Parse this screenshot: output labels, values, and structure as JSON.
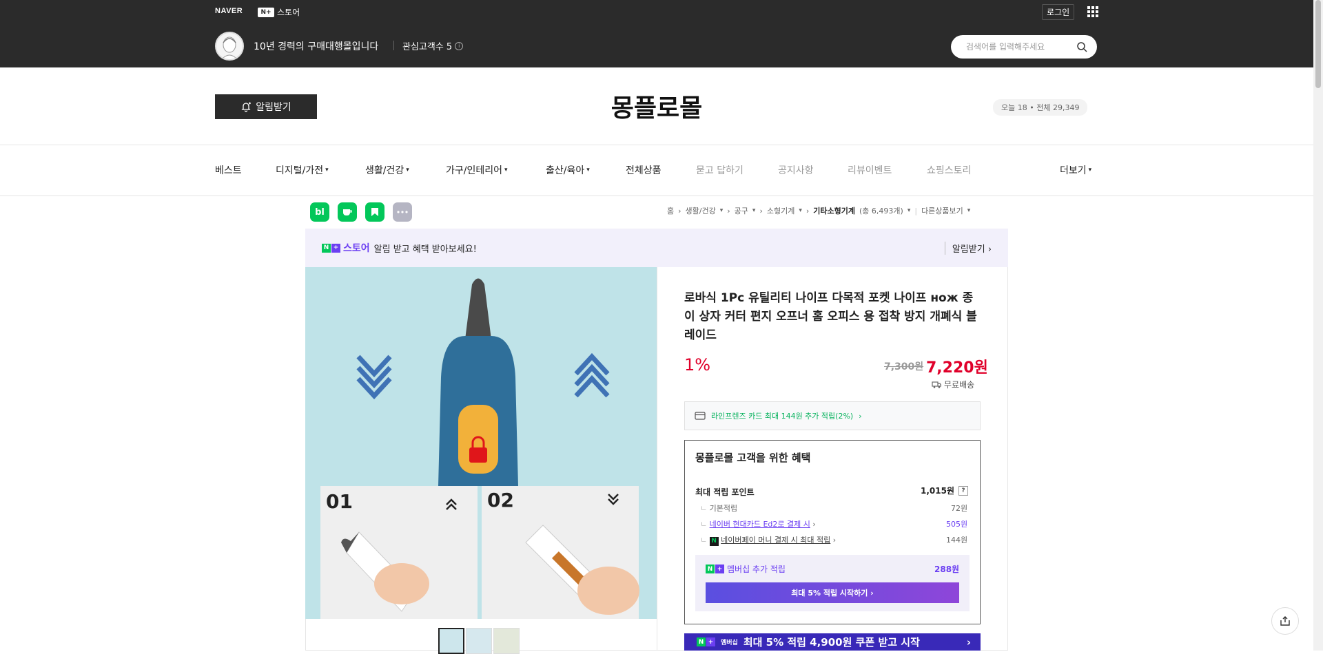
{
  "top_header": {
    "naver_logo": "NAVER",
    "nplus_box": "N+",
    "nplus_store": "스토어",
    "login": "로그인",
    "store_description": "10년 경력의 구매대행몰입니다",
    "fans_label": "관심고객수 5",
    "search_placeholder": "검색어를 입력해주세요"
  },
  "store_header": {
    "notify_button": "알림받기",
    "store_name": "몽플로몰",
    "visitors": "오늘 18 • 전체 29,349"
  },
  "nav": {
    "items": [
      {
        "label": "베스트"
      },
      {
        "label": "디지털/가전"
      },
      {
        "label": "생활/건강"
      },
      {
        "label": "가구/인테리어"
      },
      {
        "label": "출산/육아"
      },
      {
        "label": "전체상품"
      },
      {
        "label": "묻고 답하기"
      },
      {
        "label": "공지사항"
      },
      {
        "label": "리뷰이벤트"
      },
      {
        "label": "쇼핑스토리"
      }
    ],
    "more": "더보기"
  },
  "quick_icons": {
    "blog": "bl"
  },
  "breadcrumb": {
    "items": [
      "홈",
      "생활/건강",
      "공구",
      "소형기계"
    ],
    "current": "기타소형기계",
    "count": "(총 6,493개)",
    "other": "다른상품보기"
  },
  "promo": {
    "brand": "스토어",
    "text": "알림 받고 혜택 받아보세요!",
    "action": "알림받기"
  },
  "product": {
    "title": "로바식 1Pc 유틸리티 나이프 다목적 포켓 나이프 нож 종이 상자 커터 편지 오프너 홈 오피스 용 접착 방지 개폐식 블레이드",
    "discount": "1%",
    "original_price": "7,300원",
    "sale_price": "7,220원",
    "shipping": "무료배송",
    "card_benefit": "라인프렌즈 카드 최대 144원 추가 적립(2%)",
    "image_labels": {
      "step1": "01",
      "step2": "02"
    }
  },
  "benefits": {
    "title": "몽플로몰 고객을 위한 혜택",
    "max_points_label": "최대 적립 포인트",
    "max_points_value": "1,015원",
    "help": "?",
    "rows": [
      {
        "label": "기본적립",
        "value": "72원"
      },
      {
        "label": "네이버 현대카드 Ed2로 결제 시",
        "value": "505원"
      },
      {
        "label": "네이버페이 머니 결제 시 최대 적립",
        "value": "144원"
      }
    ],
    "npay_icon": "N",
    "membership_label": "멤버십 추가 적립",
    "membership_value": "288원",
    "start_button": "최대 5% 적립 시작하기",
    "banner_tag": "멤버십",
    "banner_text": "최대 5% 적립 4,900원 쿠폰 받고 시작"
  },
  "colors": {
    "header_bg": "#2b2b2b",
    "sale_red": "#e0002a",
    "naver_green": "#03c75a",
    "accent_purple": "#6b3ff2"
  }
}
